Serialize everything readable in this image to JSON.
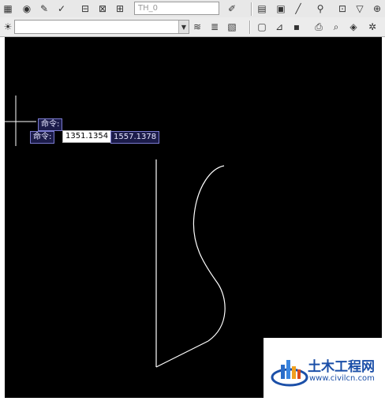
{
  "toolbar": {
    "layer_combo_value": "",
    "style_combo_value": "TH_0",
    "icons_row1": [
      "grid-icon",
      "snap-icon",
      "ortho-icon",
      "print-icon",
      "plot-icon",
      "publish-icon",
      "layer-icon",
      "properties-icon",
      "match-icon",
      "block-icon",
      "zoom-icon",
      "pan-icon"
    ],
    "icons_row2": [
      "layer-state-icon",
      "layer-previous-icon",
      "layer-isolate-icon",
      "new-icon",
      "open-icon",
      "save-icon",
      "print-preview-icon",
      "find-icon",
      "palette-icon",
      "help-icon"
    ]
  },
  "canvas": {
    "background": "#000000",
    "line_color": "#ffffff"
  },
  "command": {
    "prompt_1": "命令:",
    "prompt_2": "命令:",
    "coord_x": "1351.1354",
    "coord_y": "1557.1378"
  },
  "watermark": {
    "title": "土木工程网",
    "url": "www.civilcn.com"
  }
}
